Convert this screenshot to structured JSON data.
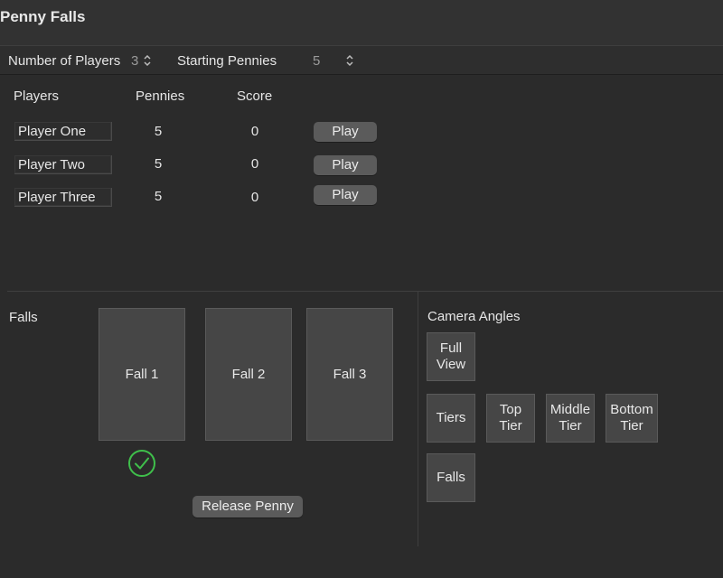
{
  "window": {
    "title": "Penny Falls"
  },
  "settings": {
    "players_label": "Number of Players",
    "players_value": "3",
    "pennies_label": "Starting Pennies",
    "pennies_value": "5"
  },
  "table": {
    "headers": {
      "players": "Players",
      "pennies": "Pennies",
      "score": "Score"
    },
    "rows": [
      {
        "name": "Player One",
        "pennies": "5",
        "score": "0",
        "action": "Play"
      },
      {
        "name": "Player Two",
        "pennies": "5",
        "score": "0",
        "action": "Play"
      },
      {
        "name": "Player Three",
        "pennies": "5",
        "score": "0",
        "action": "Play"
      }
    ]
  },
  "falls": {
    "label": "Falls",
    "items": [
      "Fall 1",
      "Fall 2",
      "Fall 3"
    ],
    "selected_index": 0,
    "release_label": "Release Penny",
    "check_color": "#3fbf4b"
  },
  "camera": {
    "label": "Camera Angles",
    "full_view": "Full View",
    "tiers": "Tiers",
    "top_tier": "Top Tier",
    "middle_tier": "Middle Tier",
    "bottom_tier": "Bottom Tier",
    "falls": "Falls"
  },
  "icons": {
    "stepper": "stepper-icon",
    "selected": "checkmark-circle-icon"
  }
}
